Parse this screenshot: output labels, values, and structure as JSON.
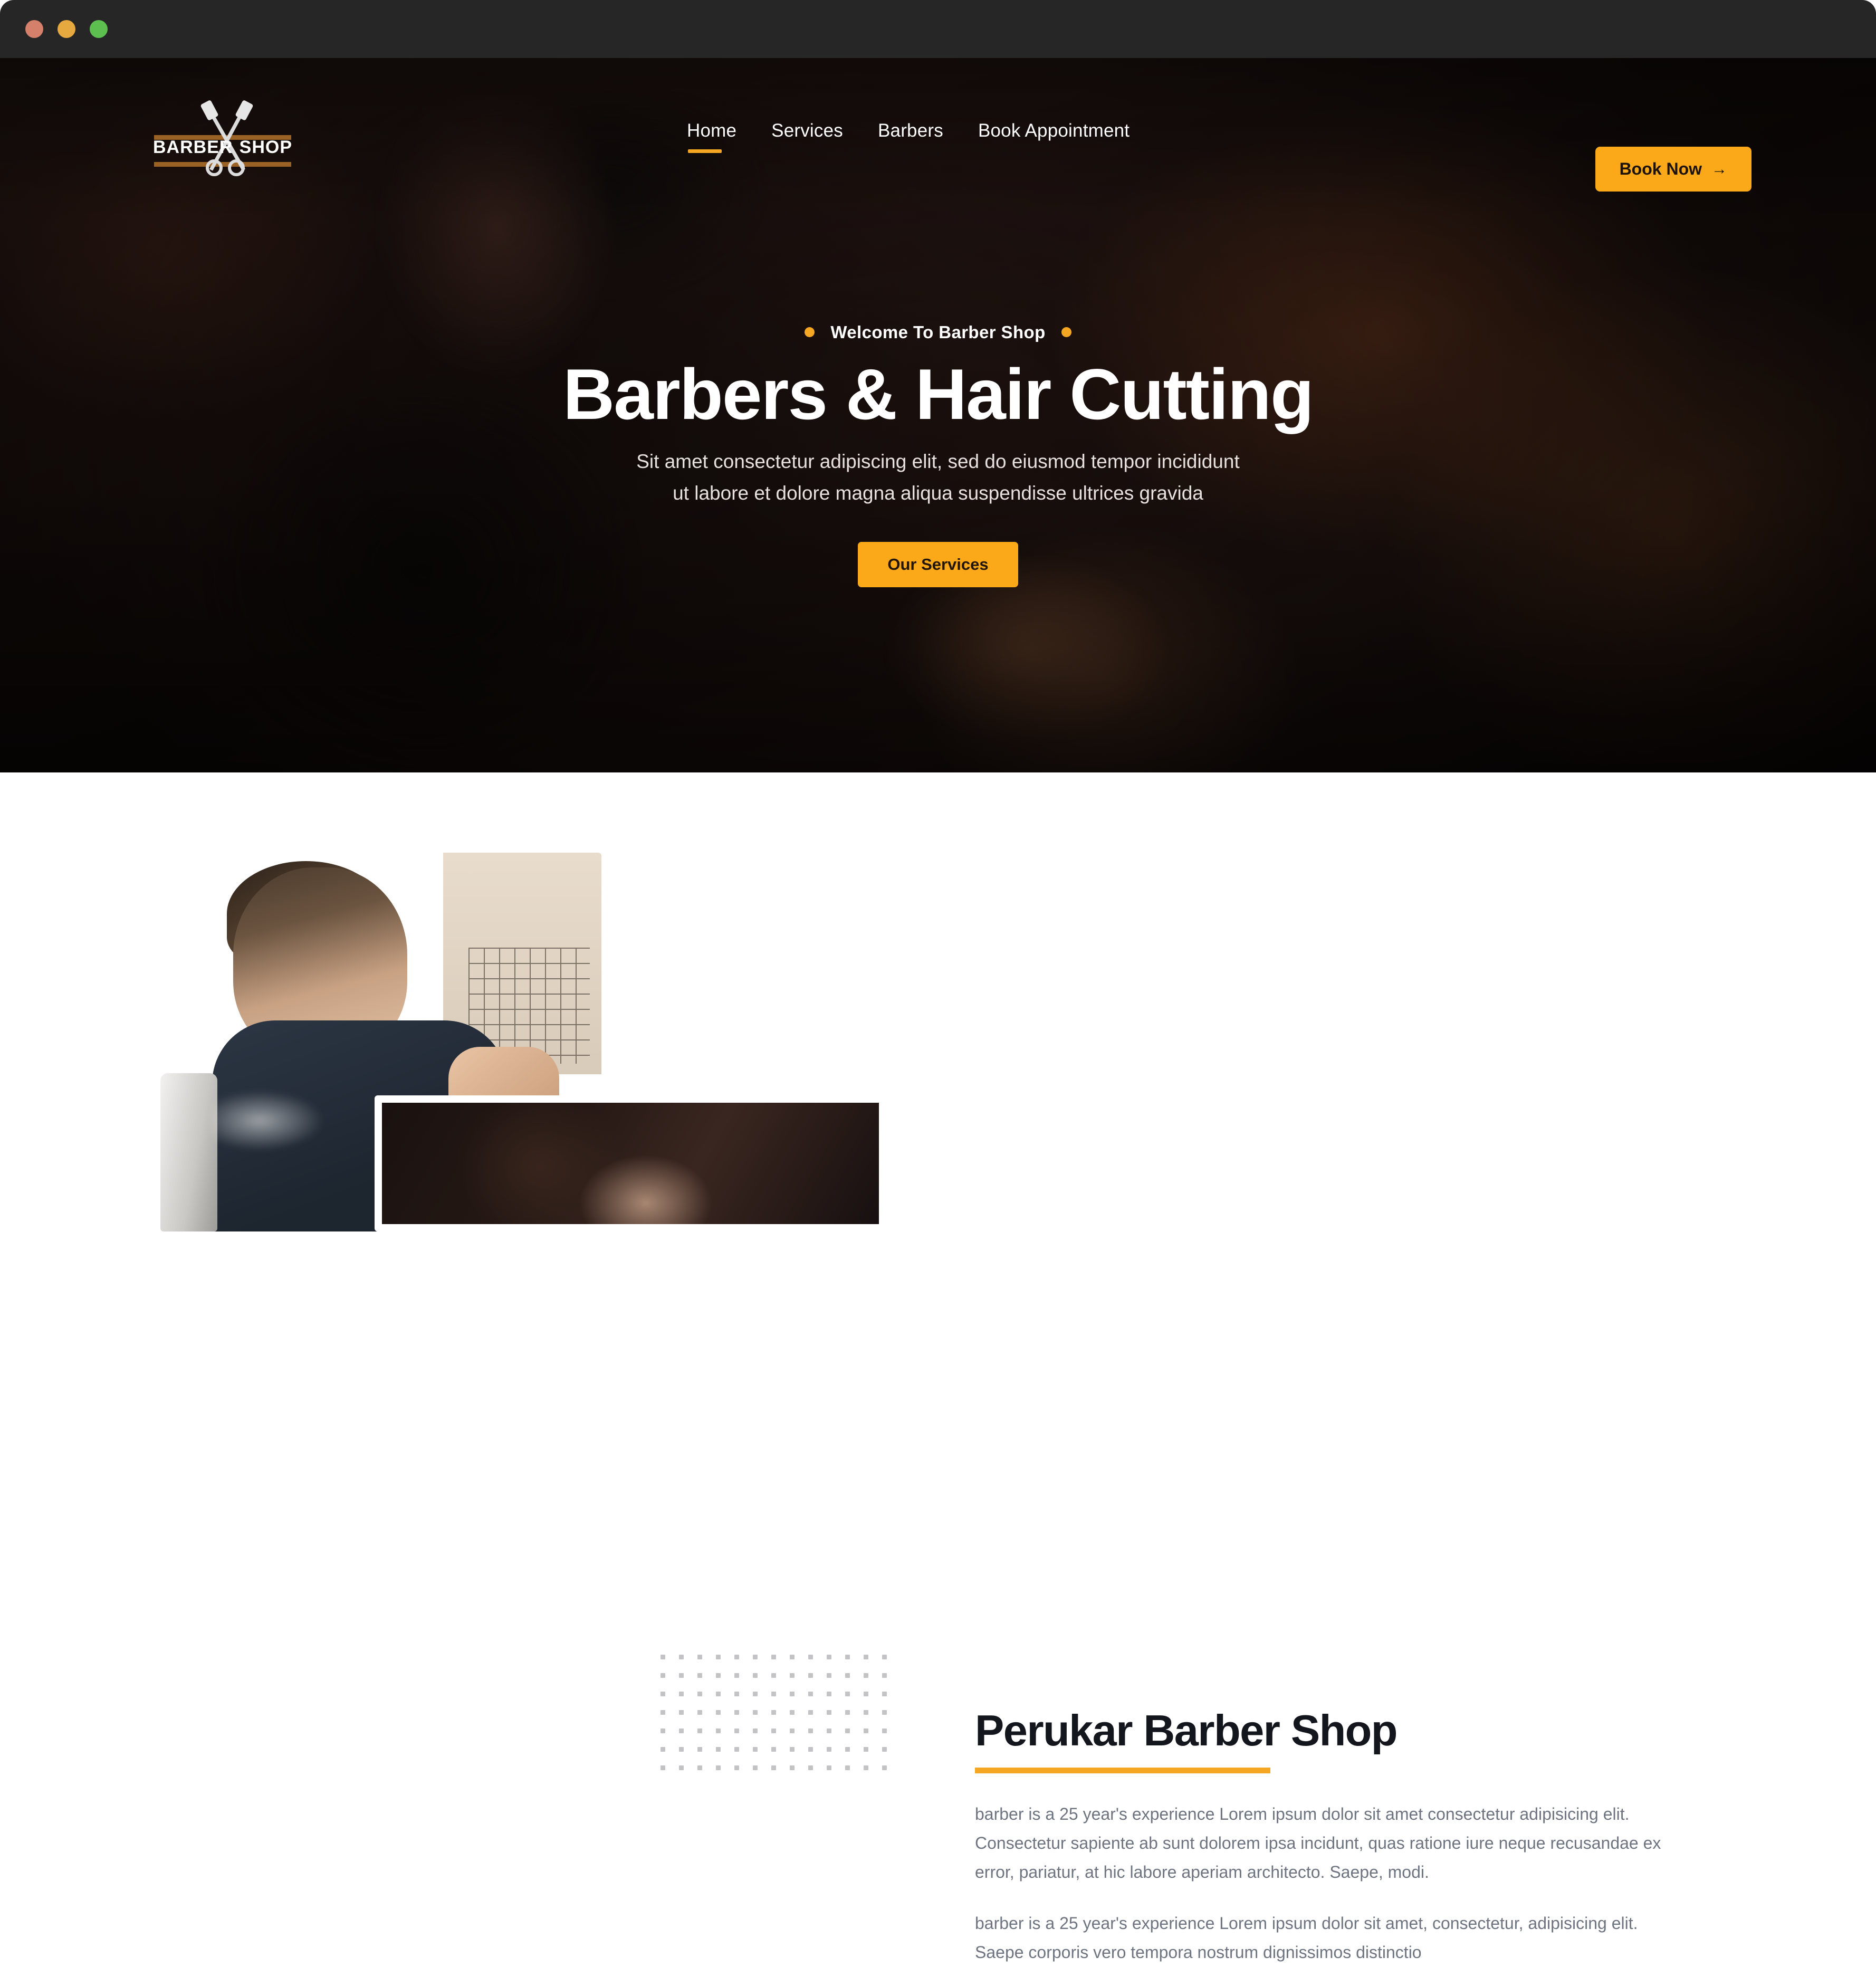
{
  "browser": {
    "traffic_lights": [
      "close",
      "minimize",
      "maximize"
    ],
    "colors": {
      "close": "#D4806A",
      "minimize": "#E5A93F",
      "maximize": "#5CBF4F"
    }
  },
  "brand": {
    "logo_word_left": "BARBER",
    "logo_word_right": "SHOP",
    "logo_icon": "razor-scissors-icon"
  },
  "nav": {
    "items": [
      {
        "label": "Home",
        "active": true
      },
      {
        "label": "Services",
        "active": false
      },
      {
        "label": "Barbers",
        "active": false
      },
      {
        "label": "Book Appointment",
        "active": false
      }
    ],
    "cta": {
      "label": "Book Now",
      "icon": "arrow-right-icon"
    }
  },
  "hero": {
    "eyebrow": "Welcome To Barber Shop",
    "title": "Barbers & Hair Cutting",
    "subtitle_line1": "Sit amet consectetur adipiscing elit, sed do eiusmod tempor incididunt",
    "subtitle_line2": "ut labore et dolore magna aliqua suspendisse ultrices gravida",
    "cta": {
      "label": "Our Services"
    }
  },
  "about": {
    "title": "Perukar Barber Shop",
    "paragraph1": "barber is a 25 year's experience Lorem ipsum dolor sit amet consectetur adipisicing elit. Consectetur sapiente ab sunt dolorem ipsa incidunt, quas ratione iure neque recusandae ex error, pariatur, at hic labore aperiam architecto. Saepe, modi.",
    "paragraph2": "barber is a 25 year's experience Lorem ipsum dolor sit amet, consectetur, adipisicing elit. Saepe corporis vero tempora nostrum dignissimos distinctio",
    "image_main_alt": "barber-spraying-hairspray",
    "image_sub_alt": "barber-shaving-client"
  },
  "colors": {
    "accent": "#F5A623",
    "accent_button": "#FBA919",
    "chrome": "#262626",
    "heading": "#13161c",
    "body_text": "#6d7480",
    "dot_pattern": "#c3c3c6"
  }
}
